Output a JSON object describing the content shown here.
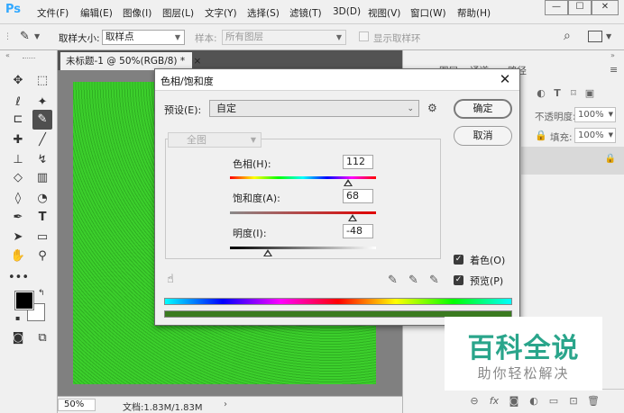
{
  "app": {
    "logo": "Ps",
    "menu": [
      "文件(F)",
      "编辑(E)",
      "图像(I)",
      "图层(L)",
      "文字(Y)",
      "选择(S)",
      "滤镜(T)",
      "3D(D)",
      "视图(V)",
      "窗口(W)",
      "帮助(H)"
    ]
  },
  "options_bar": {
    "sample_size_label": "取样大小:",
    "sample_size_value": "取样点",
    "sample_label": "样本:",
    "sample_value": "所有图层",
    "show_ring_label": "显示取样环"
  },
  "document": {
    "tab_title": "未标题-1 @ 50%(RGB/8) *",
    "close_glyph": "×",
    "zoom": "50%",
    "doc_size": "文档:1.83M/1.83M",
    "canvas_color": "#33c126"
  },
  "right_panel": {
    "tabs": [
      "图层",
      "通道",
      "路径"
    ],
    "opacity_label": "不透明度:",
    "opacity_value": "100%",
    "fill_label": "填充:",
    "fill_value": "100%"
  },
  "dialog": {
    "title": "色相/饱和度",
    "preset_label": "预设(E):",
    "preset_value": "自定",
    "ok_label": "确定",
    "cancel_label": "取消",
    "channel_value": "全图",
    "hue": {
      "label": "色相(H):",
      "value": "112",
      "min": -180,
      "max": 180,
      "current": 112
    },
    "saturation": {
      "label": "饱和度(A):",
      "value": "68",
      "min": -100,
      "max": 100,
      "current": 68
    },
    "lightness": {
      "label": "明度(I):",
      "value": "-48",
      "min": -100,
      "max": 100,
      "current": -48
    },
    "colorize_label": "着色(O)",
    "colorize_checked": true,
    "preview_label": "预览(P)",
    "preview_checked": true
  },
  "watermark": {
    "title": "百科全说",
    "subtitle": "助你轻松解决",
    "color": "#2aa58b"
  }
}
